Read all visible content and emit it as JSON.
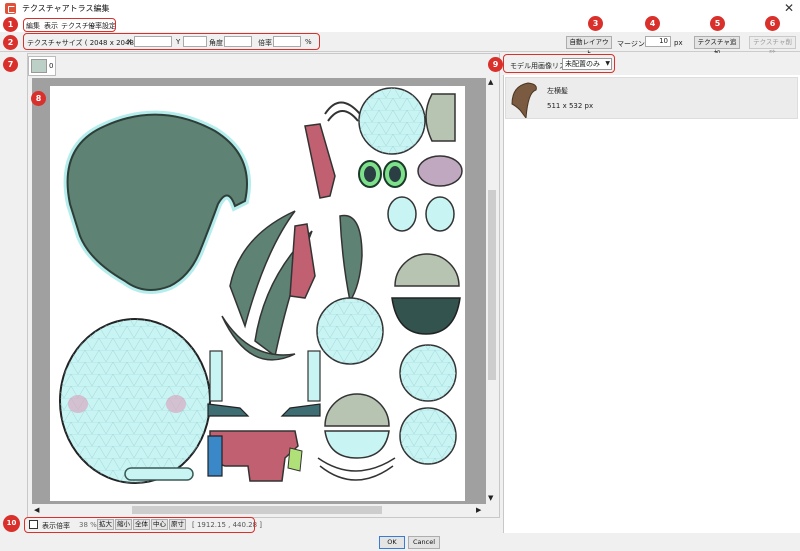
{
  "window": {
    "title": "テクスチャアトラス編集",
    "close": "✕"
  },
  "menu": [
    "編集",
    "表示",
    "テクスチャ",
    "倍率設定"
  ],
  "toolbar": {
    "texture_size_label": "テクスチャサイズ ( 2048 x 2048 )",
    "x_label": "X",
    "x_value": "",
    "y_label": "Y",
    "y_value": "",
    "angle_label": "角度",
    "angle_value": "",
    "scale_label": "倍率",
    "scale_value": "",
    "percent": "%",
    "auto_layout": "自動レイアウト",
    "margin_label": "マージン",
    "margin_value": "10",
    "px": "px",
    "add_texture": "テクスチャ追加",
    "delete_texture": "テクスチャ削除"
  },
  "thumb_tab": {
    "index": "0"
  },
  "right_panel": {
    "list_label": "モデル用画像リスト",
    "filter_value": "未配置のみ",
    "items": [
      {
        "name": "左横髪",
        "size": "511 x 532 px"
      }
    ]
  },
  "status": {
    "show_scale_label": "表示倍率",
    "scale_value": "38 %",
    "zoom_in": "拡大",
    "zoom_out": "縮小",
    "whole": "全体",
    "center": "中心",
    "actual": "原寸",
    "coords": "[ 1912.15 , 440.28 ]"
  },
  "dialog": {
    "ok": "OK",
    "cancel": "Cancel"
  },
  "badges": [
    "1",
    "2",
    "3",
    "4",
    "5",
    "6",
    "7",
    "8",
    "9",
    "10"
  ],
  "colors": {
    "accent_red": "#d9302b",
    "mesh_cyan": "#c8f4f4",
    "dark_green": "#5a8070",
    "pink": "#c06070"
  }
}
